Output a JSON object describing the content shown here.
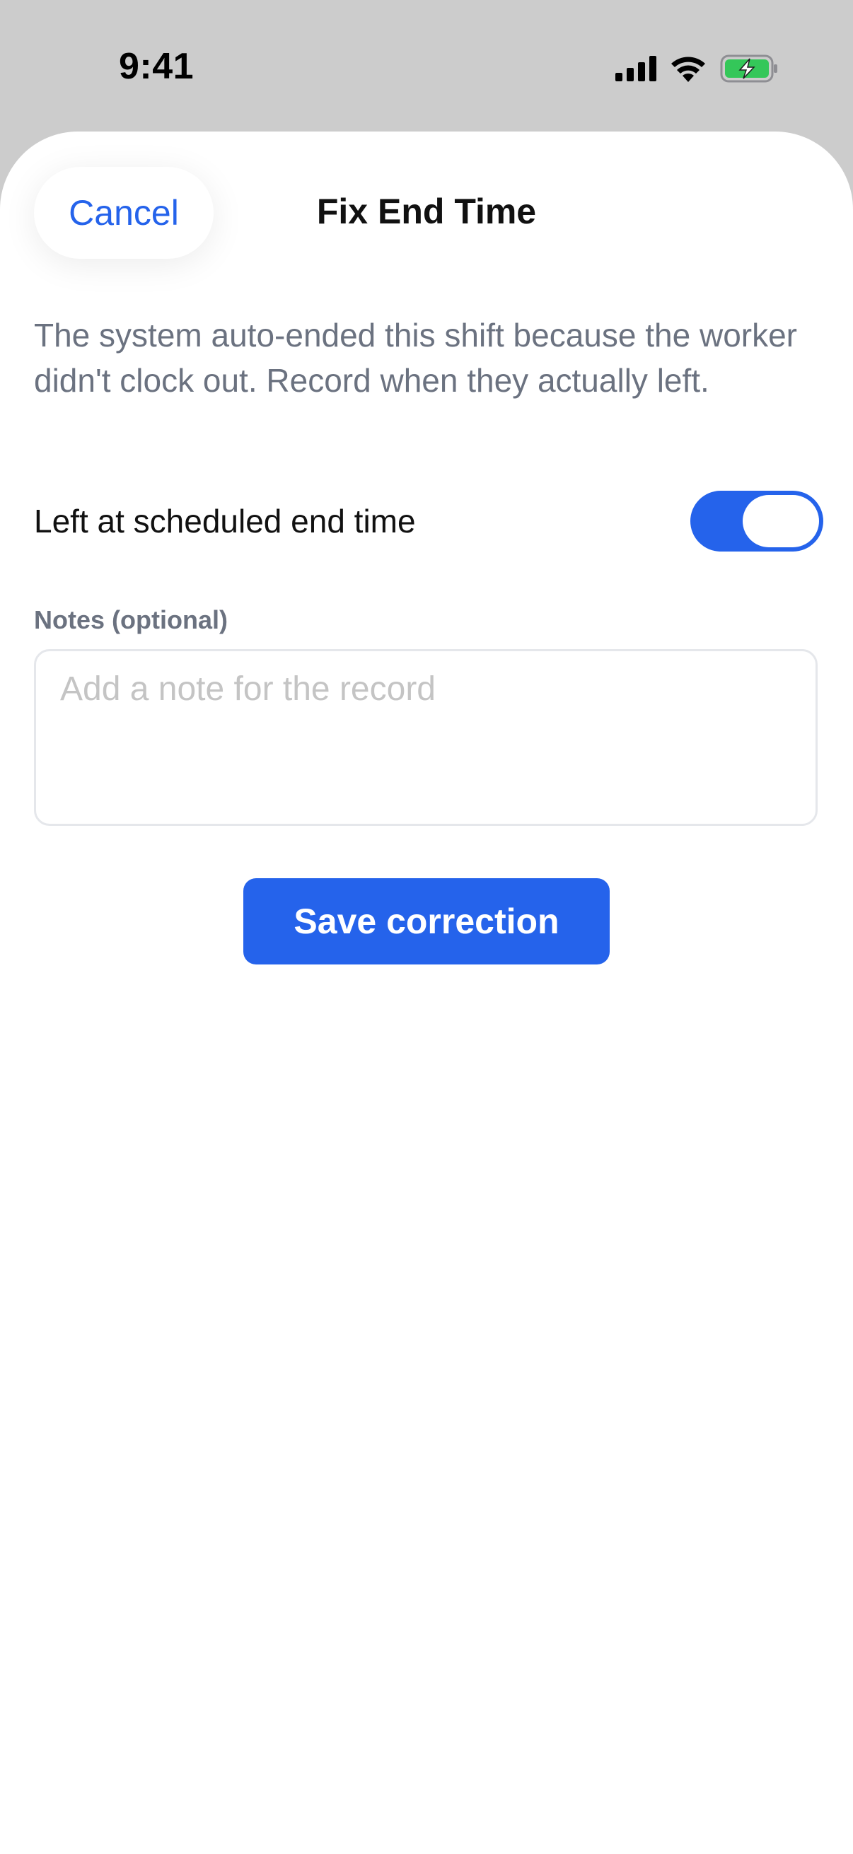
{
  "status_bar": {
    "time": "9:41",
    "icons": [
      "cellular-signal-icon",
      "wifi-icon",
      "battery-charging-icon"
    ],
    "battery_color": "#34c759"
  },
  "sheet": {
    "title": "Fix End Time",
    "cancel_label": "Cancel",
    "description": "The system auto-ended this shift because the worker didn't clock out. Record when they actually left.",
    "toggle": {
      "label": "Left at scheduled end time",
      "on": true
    },
    "notes": {
      "label": "Notes (optional)",
      "placeholder": "Add a note for the record",
      "value": ""
    },
    "save_label": "Save correction"
  },
  "colors": {
    "accent": "#2563eb",
    "muted_text": "#6b7280",
    "backdrop": "#cccccc"
  }
}
